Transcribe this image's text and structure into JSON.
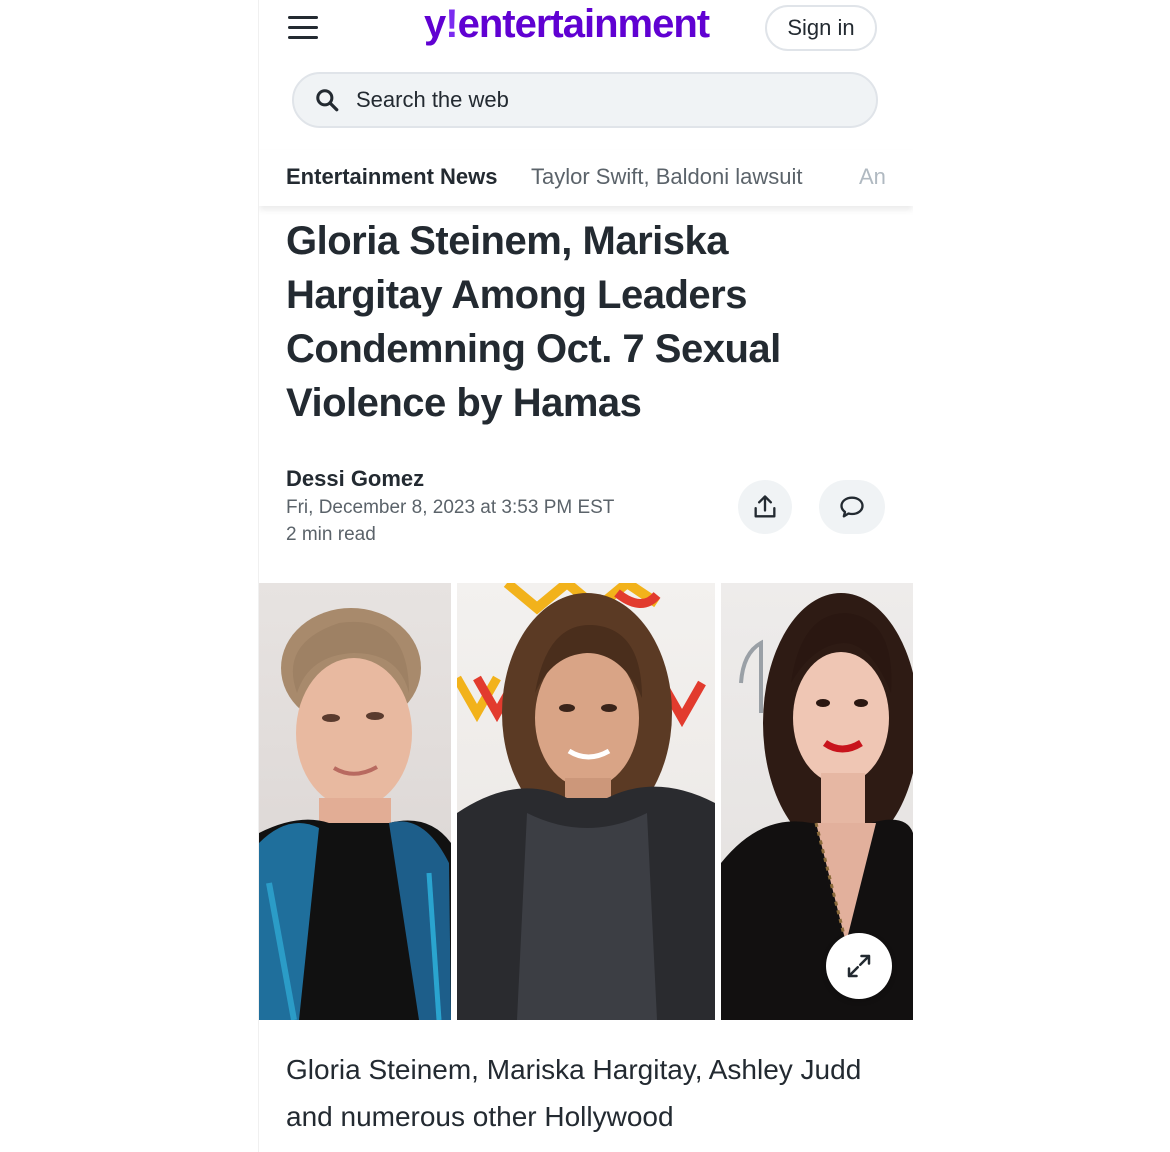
{
  "header": {
    "logo_y": "y",
    "logo_bang": "!",
    "logo_text": "entertainment",
    "signin_label": "Sign in"
  },
  "search": {
    "placeholder": "Search the web"
  },
  "nav": {
    "tabs": [
      {
        "label": "Entertainment News"
      },
      {
        "label": "Taylor Swift, Baldoni lawsuit"
      },
      {
        "label": "An"
      }
    ]
  },
  "article": {
    "headline": "Gloria Steinem, Mariska Hargitay Among Leaders Condemning Oct. 7 Sexual Violence by Hamas",
    "author": "Dessi Gomez",
    "date": "Fri, December 8, 2023 at 3:53 PM EST",
    "read_time": "2 min read",
    "caption": "Gloria Steinem, Mariska Hargitay, Ashley Judd and numerous other Hollywood"
  },
  "hero_image": {
    "photos": [
      "gloria-steinem-photo",
      "mariska-hargitay-photo",
      "ashley-judd-photo"
    ]
  },
  "icons": {
    "menu": "hamburger-menu-icon",
    "search": "search-icon",
    "share": "share-icon",
    "comment": "comment-icon",
    "expand": "expand-icon"
  },
  "colors": {
    "brand": "#6001d2",
    "text": "#232a31",
    "muted": "#5b636a",
    "pill_bg": "#f0f3f5"
  }
}
